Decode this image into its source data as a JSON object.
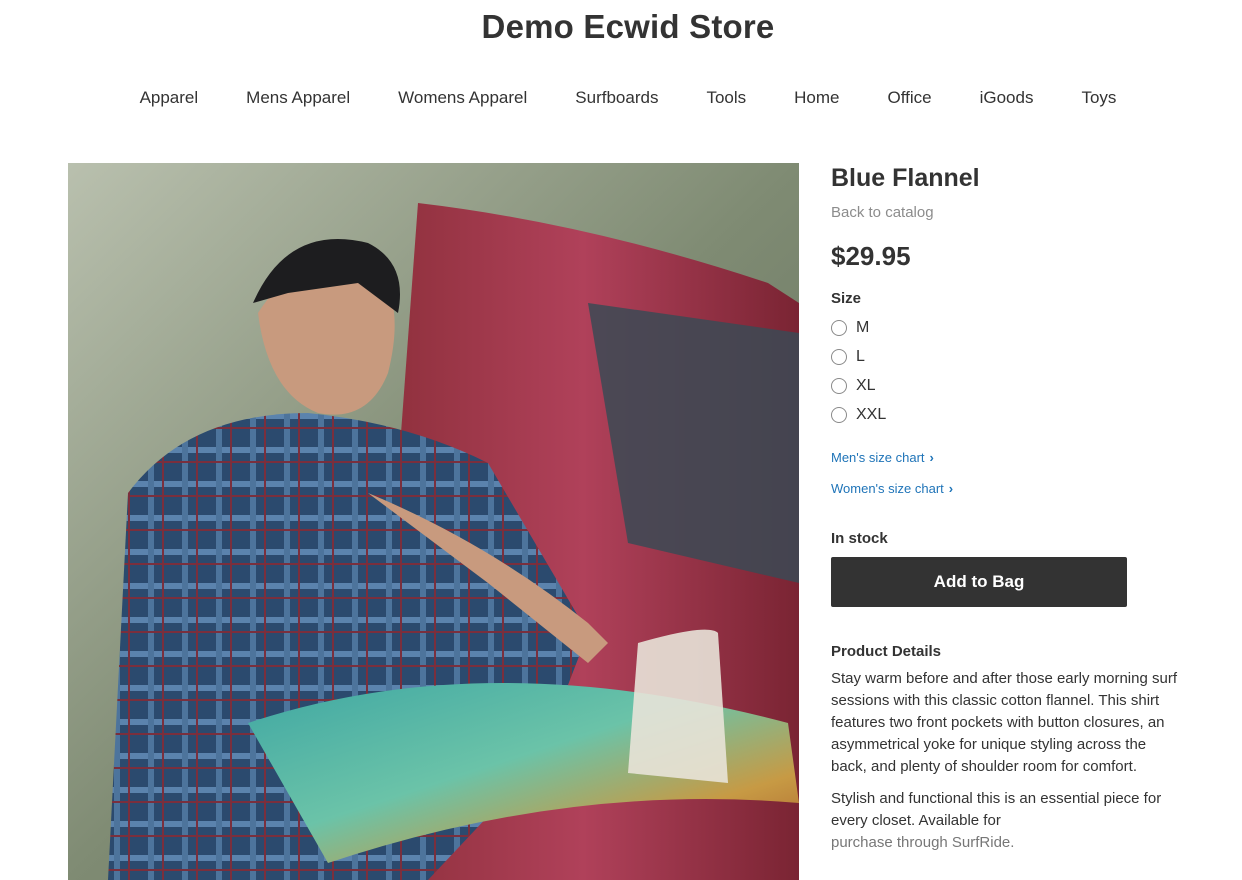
{
  "store": {
    "title": "Demo Ecwid Store"
  },
  "nav": {
    "items": [
      "Apparel",
      "Mens Apparel",
      "Womens Apparel",
      "Surfboards",
      "Tools",
      "Home",
      "Office",
      "iGoods",
      "Toys"
    ]
  },
  "product": {
    "title": "Blue Flannel",
    "back_label": "Back to catalog",
    "price": "$29.95",
    "size_label": "Size",
    "sizes": [
      "M",
      "L",
      "XL",
      "XXL"
    ],
    "mens_chart_label": "Men's size chart",
    "womens_chart_label": "Women's size chart",
    "stock_status": "In stock",
    "add_button_label": "Add to Bag",
    "details_title": "Product Details",
    "description": [
      "Stay warm before and after those early morning surf sessions with this classic cotton flannel. This shirt features two front pockets with button closures, an asymmetrical yoke for unique styling across the back, and plenty of shoulder room for comfort.",
      "Stylish and functional this is an essential piece for every closet. Available for",
      "purchase through SurfRide."
    ]
  },
  "icons": {
    "chevron": "chevron-right-icon",
    "radio": "radio-unchecked-icon"
  },
  "colors": {
    "button_bg": "#333333",
    "link": "#1f74b8",
    "muted": "#8c8c8c"
  }
}
